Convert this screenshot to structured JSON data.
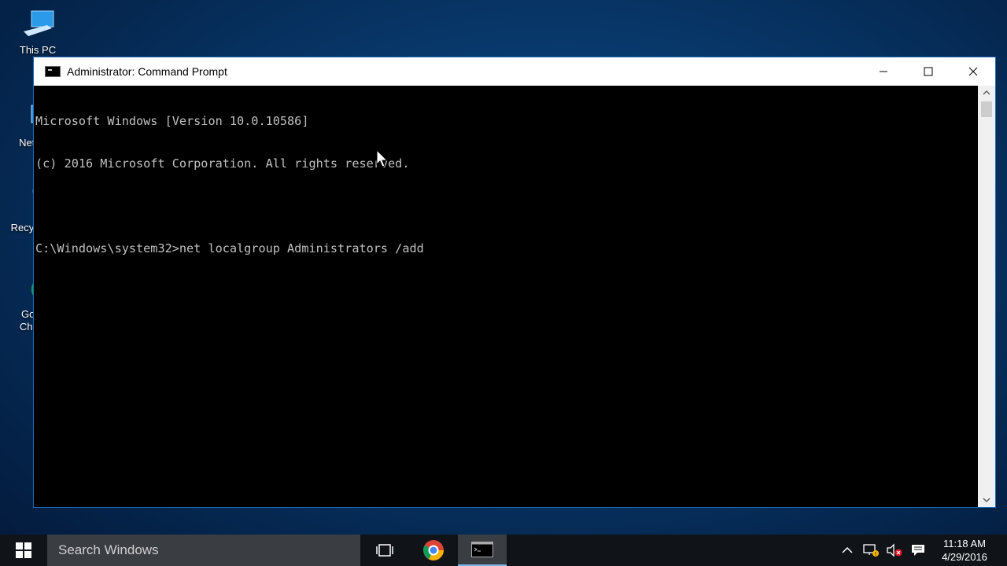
{
  "desktop": {
    "icons": [
      {
        "label": "This PC",
        "icon": "this-pc-icon"
      },
      {
        "label": "Network",
        "icon": "network-icon"
      },
      {
        "label": "Recycle Bin",
        "icon": "recycle-bin-icon"
      },
      {
        "label": "Google Chrome",
        "icon": "chrome-icon"
      }
    ]
  },
  "window": {
    "title": "Administrator: Command Prompt",
    "controls": {
      "minimize": "–",
      "maximize": "☐",
      "close": "✕"
    },
    "console_lines": [
      "Microsoft Windows [Version 10.0.10586]",
      "(c) 2016 Microsoft Corporation. All rights reserved.",
      "",
      "C:\\Windows\\system32>net localgroup Administrators /add"
    ]
  },
  "taskbar": {
    "search_placeholder": "Search Windows",
    "apps": [
      {
        "name": "task-view",
        "icon": "task-view-icon"
      },
      {
        "name": "chrome",
        "icon": "chrome-icon"
      },
      {
        "name": "command-prompt",
        "icon": "cmd-icon",
        "active": true
      }
    ],
    "tray": {
      "time": "11:18 AM",
      "date": "4/29/2016"
    }
  },
  "colors": {
    "accent": "#1b6ab8",
    "console_text": "#c0c0c0",
    "taskbar": "#101418"
  }
}
